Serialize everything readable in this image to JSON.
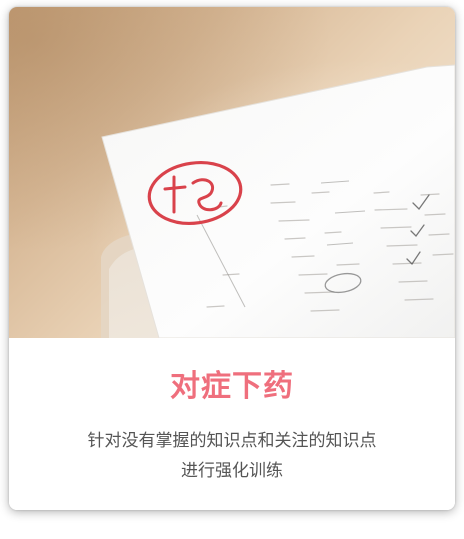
{
  "card": {
    "title": "对症下药",
    "description_line1": "针对没有掌握的知识点和关注的知识点",
    "description_line2": "进行强化训练"
  },
  "colors": {
    "title": "#ef6f7d",
    "description": "#555555",
    "paper": "#fbfbfb",
    "grade_mark": "#d9424b"
  }
}
